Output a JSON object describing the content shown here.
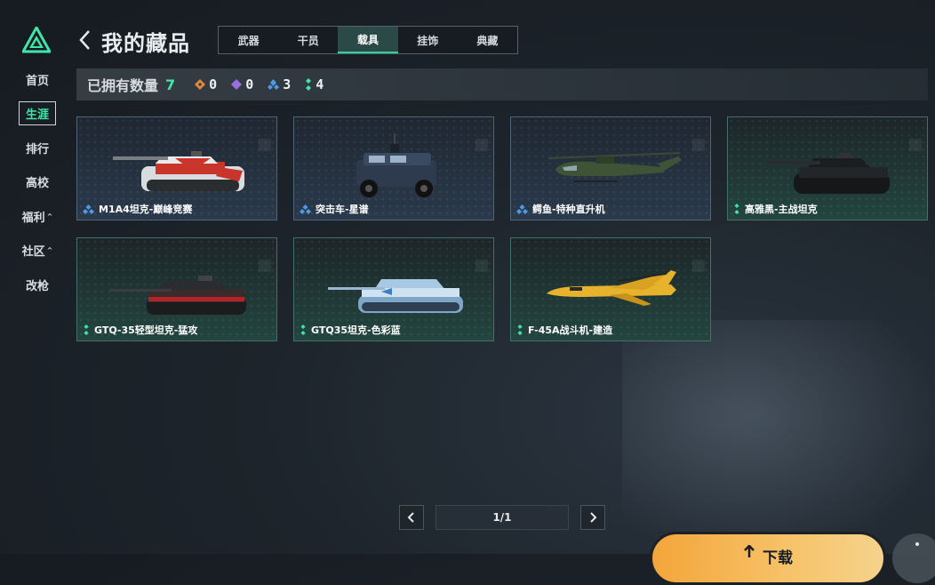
{
  "header": {
    "title": "我的藏品",
    "tabs": [
      {
        "label": "武器",
        "active": false
      },
      {
        "label": "干员",
        "active": false
      },
      {
        "label": "载具",
        "active": true
      },
      {
        "label": "挂饰",
        "active": false
      },
      {
        "label": "典藏",
        "active": false
      }
    ]
  },
  "nav": {
    "items": [
      {
        "label": "首页"
      },
      {
        "label": "生涯",
        "active": true
      },
      {
        "label": "排行"
      },
      {
        "label": "高校"
      },
      {
        "label": "福利",
        "caret": "^"
      },
      {
        "label": "社区",
        "caret": "^"
      },
      {
        "label": "改枪"
      }
    ]
  },
  "summary": {
    "label": "已拥有数量",
    "count": "7",
    "rarities": [
      {
        "icon": "orange-diamond-icon",
        "color": "#e0893c",
        "value": "0"
      },
      {
        "icon": "purple-diamond-icon",
        "color": "#9a6de0",
        "value": "0"
      },
      {
        "icon": "blue-diamond-icon",
        "color": "#4d9be8",
        "value": "3"
      },
      {
        "icon": "green-diamond-icon",
        "color": "#3fe6a7",
        "value": "4"
      }
    ]
  },
  "items": [
    {
      "name": "M1A4坦克-巅峰竞赛",
      "rarity": "blue"
    },
    {
      "name": "突击车-星谱",
      "rarity": "blue"
    },
    {
      "name": "鳄鱼-特种直升机",
      "rarity": "blue"
    },
    {
      "name": "高雅黑-主战坦克",
      "rarity": "green"
    },
    {
      "name": "GTQ-35轻型坦克-猛攻",
      "rarity": "green"
    },
    {
      "name": "GTQ35坦克-色彩蓝",
      "rarity": "green"
    },
    {
      "name": "F-45A战斗机-建造",
      "rarity": "green"
    }
  ],
  "pagination": {
    "indicator": "1/1"
  },
  "download": {
    "label": "下载"
  },
  "colors": {
    "accent": "#3fe6a7",
    "download": "#f7b54a"
  }
}
